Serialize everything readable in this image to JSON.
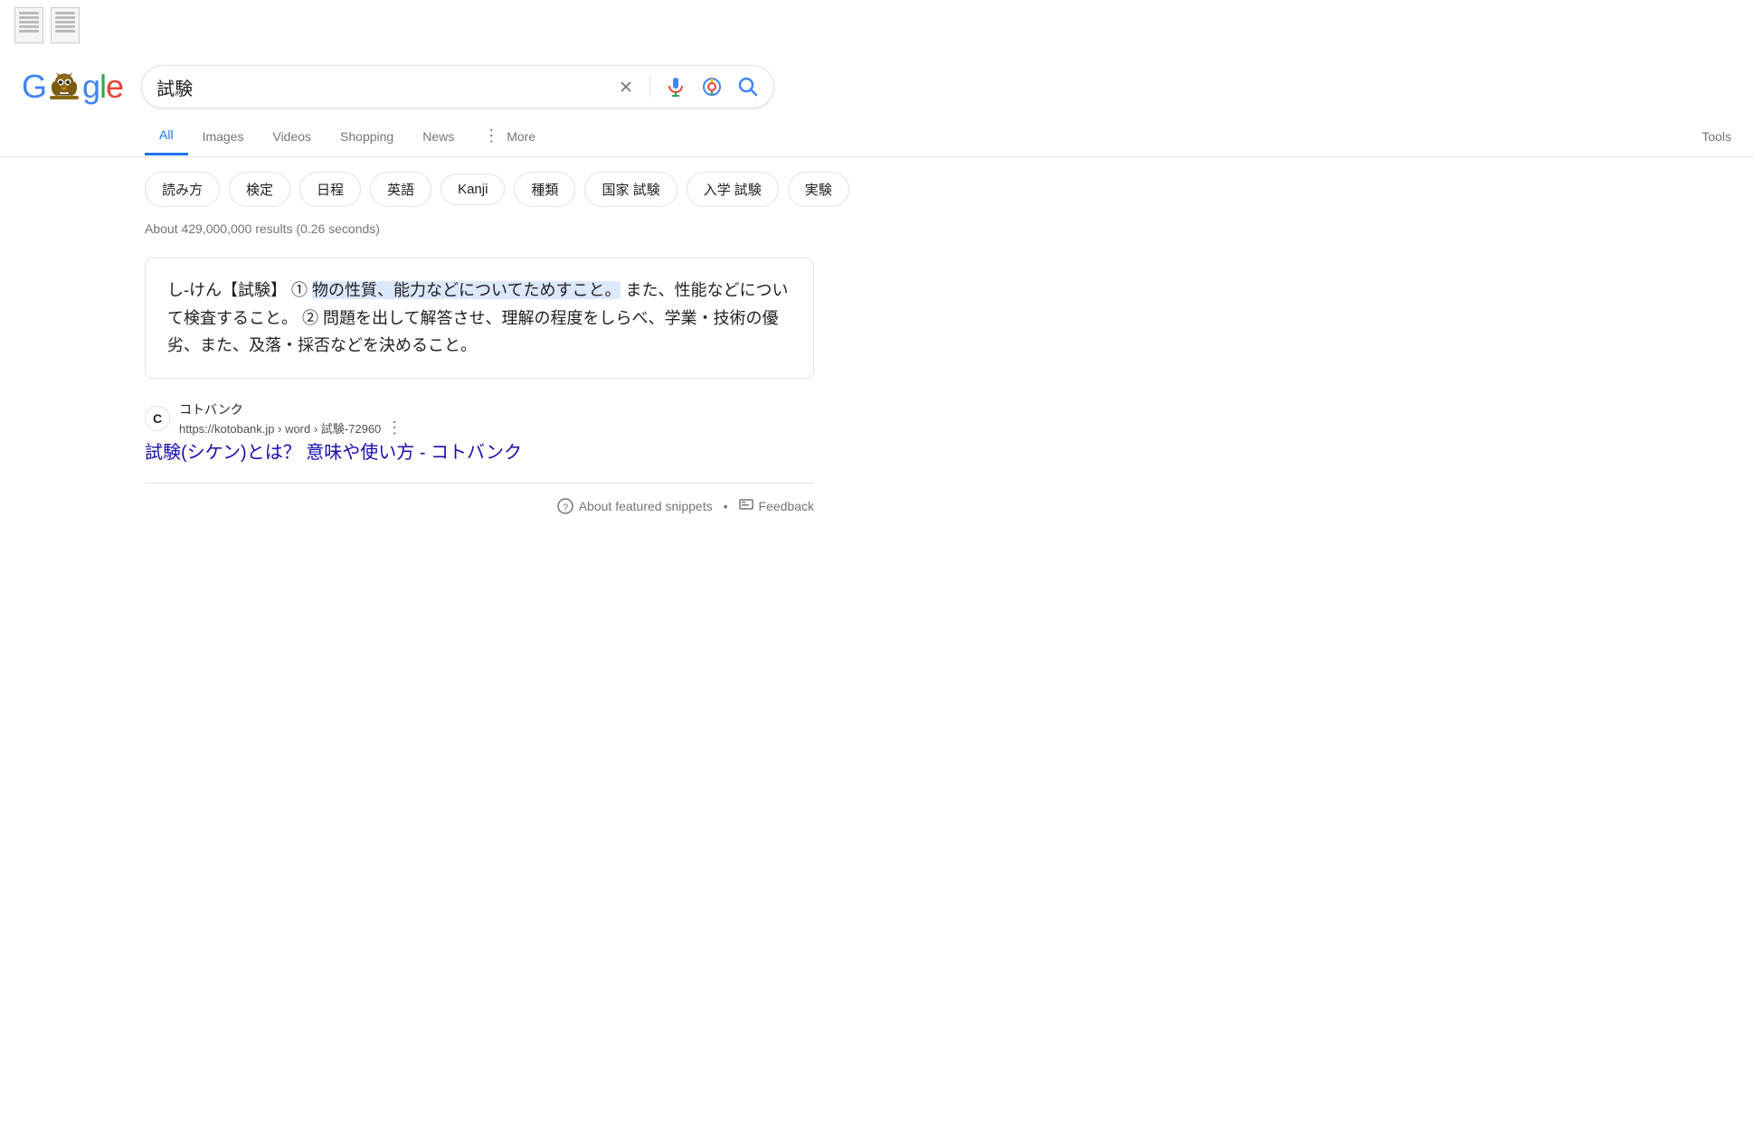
{
  "header": {
    "logo": "Google",
    "search_query": "試験",
    "clear_label": "×",
    "mic_label": "voice search",
    "lens_label": "search by image",
    "search_submit_label": "search"
  },
  "nav": {
    "tabs": [
      {
        "id": "all",
        "label": "All",
        "active": true
      },
      {
        "id": "images",
        "label": "Images",
        "active": false
      },
      {
        "id": "videos",
        "label": "Videos",
        "active": false
      },
      {
        "id": "shopping",
        "label": "Shopping",
        "active": false
      },
      {
        "id": "news",
        "label": "News",
        "active": false
      },
      {
        "id": "more",
        "label": "More",
        "active": false
      },
      {
        "id": "tools",
        "label": "Tools",
        "active": false
      }
    ]
  },
  "chips": [
    {
      "label": "読み方"
    },
    {
      "label": "検定"
    },
    {
      "label": "日程"
    },
    {
      "label": "英語"
    },
    {
      "label": "Kanji"
    },
    {
      "label": "種類"
    },
    {
      "label": "国家 試験"
    },
    {
      "label": "入学 試験"
    },
    {
      "label": "実験"
    }
  ],
  "results_meta": {
    "count_text": "About 429,000,000 results (0.26 seconds)"
  },
  "featured_snippet": {
    "text_before_highlight": "し‐けん【試験】 ① ",
    "text_highlighted": "物の性質、能力などについてためすこと。",
    "text_after": " また、性能などについて検査すること。 ② 問題を出して解答させ、理解の程度をしらべ、学業・技術の優劣、また、及落・採否などを決めること。"
  },
  "result": {
    "favicon_letter": "C",
    "site_name": "コトバンク",
    "url": "https://kotobank.jp › word › 試験-72960",
    "title": "試験(シケン)とは？ 意味や使い方 - コトバンク"
  },
  "snippet_footer": {
    "about_label": "About featured snippets",
    "dot": "•",
    "feedback_label": "Feedback"
  }
}
